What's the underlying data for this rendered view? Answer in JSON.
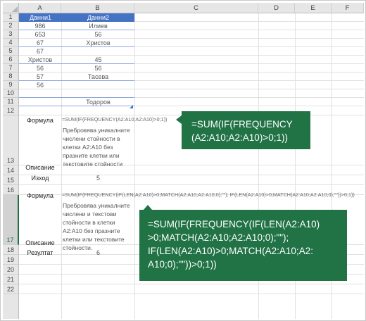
{
  "columns": [
    "A",
    "B",
    "C",
    "D",
    "E",
    "F"
  ],
  "rows": [
    "1",
    "2",
    "3",
    "4",
    "5",
    "6",
    "7",
    "8",
    "9",
    "10",
    "11",
    "12",
    "13",
    "14",
    "15",
    "16",
    "17",
    "18",
    "19",
    "20",
    "21",
    "22"
  ],
  "table": {
    "headers": [
      "Данни1",
      "Данни2"
    ],
    "col_a": [
      "986",
      "653",
      "67",
      "67",
      "Христов",
      "56",
      "57",
      "56",
      ""
    ],
    "col_b": [
      "Илиев",
      "56",
      "Христов",
      "",
      "45",
      "56",
      "Тасева",
      "",
      "Тодоров"
    ]
  },
  "example1": {
    "formula_label": "Формула",
    "formula_text": "=SUM(IF(FREQUENCY(A2:A10;A2:A10)>0;1))",
    "description_label": "Описание",
    "description_text": "Пребровява уникалните числени стойности в клетки A2:A10 без празните клетки или текстовите стойности",
    "result_label": "Изход",
    "result_value": "5"
  },
  "example2": {
    "formula_label": "Формула",
    "formula_text": "=SUM(IF(FREQUENCY(IF(LEN(A2:A10)>0;MATCH(A2:A10;A2:A10;0);\"\"); IF(LEN(A2:A10)>0;MATCH(A2:A10;A2:A10;0);\"\"))>0;1))",
    "description_label": "Описание",
    "description_text": "Пребровява уникалните числени и текстови стойности в клетки A2:A10 без празните клетки или текстовите стойности.",
    "result_label": "Резултат",
    "result_value": "6"
  },
  "callout1": {
    "line1": "=SUM(IF(FREQUENCY",
    "line2": "(A2:A10;A2:A10)>0;1))"
  },
  "callout2": {
    "line1": "=SUM(IF(FREQUENCY(IF(LEN(A2:A10)",
    "line2": ">0;MATCH(A2:A10;A2:A10;0);\"\");",
    "line3": "IF(LEN(A2:A10)>0;MATCH(A2:A10;A2:",
    "line4": "A10;0);\"\"))>0;1))"
  },
  "colors": {
    "header_fill": "#4472c4",
    "callout_fill": "#217346",
    "grid": "#e1e1e1"
  }
}
